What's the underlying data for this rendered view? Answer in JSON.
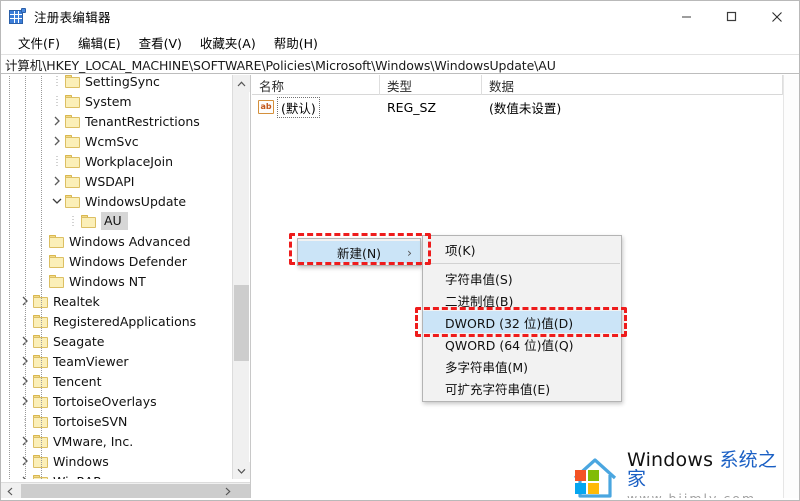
{
  "window": {
    "title": "注册表编辑器",
    "icon": "registry-editor-icon",
    "minimize_label": "最小化",
    "maximize_label": "最大化",
    "close_label": "关闭"
  },
  "menubar": {
    "items": [
      {
        "label": "文件(F)",
        "name": "menu-file"
      },
      {
        "label": "编辑(E)",
        "name": "menu-edit"
      },
      {
        "label": "查看(V)",
        "name": "menu-view"
      },
      {
        "label": "收藏夹(A)",
        "name": "menu-favorites"
      },
      {
        "label": "帮助(H)",
        "name": "menu-help"
      }
    ]
  },
  "address": {
    "path": "计算机\\HKEY_LOCAL_MACHINE\\SOFTWARE\\Policies\\Microsoft\\Windows\\WindowsUpdate\\AU"
  },
  "tree": {
    "items": [
      {
        "label": "SettingSync",
        "indent": 3,
        "expander": "none",
        "selected": false
      },
      {
        "label": "System",
        "indent": 3,
        "expander": "none",
        "selected": false
      },
      {
        "label": "TenantRestrictions",
        "indent": 3,
        "expander": "collapsed",
        "selected": false
      },
      {
        "label": "WcmSvc",
        "indent": 3,
        "expander": "collapsed",
        "selected": false
      },
      {
        "label": "WorkplaceJoin",
        "indent": 3,
        "expander": "none",
        "selected": false
      },
      {
        "label": "WSDAPI",
        "indent": 3,
        "expander": "collapsed",
        "selected": false
      },
      {
        "label": "WindowsUpdate",
        "indent": 3,
        "expander": "expanded",
        "selected": false
      },
      {
        "label": "AU",
        "indent": 4,
        "expander": "none",
        "selected": true
      },
      {
        "label": "Windows Advanced",
        "indent": 2,
        "expander": "none",
        "selected": false
      },
      {
        "label": "Windows Defender",
        "indent": 2,
        "expander": "none",
        "selected": false
      },
      {
        "label": "Windows NT",
        "indent": 2,
        "expander": "none",
        "selected": false
      },
      {
        "label": "Realtek",
        "indent": 1,
        "expander": "collapsed",
        "selected": false
      },
      {
        "label": "RegisteredApplications",
        "indent": 1,
        "expander": "none",
        "selected": false
      },
      {
        "label": "Seagate",
        "indent": 1,
        "expander": "collapsed",
        "selected": false
      },
      {
        "label": "TeamViewer",
        "indent": 1,
        "expander": "collapsed",
        "selected": false
      },
      {
        "label": "Tencent",
        "indent": 1,
        "expander": "collapsed",
        "selected": false
      },
      {
        "label": "TortoiseOverlays",
        "indent": 1,
        "expander": "collapsed",
        "selected": false
      },
      {
        "label": "TortoiseSVN",
        "indent": 1,
        "expander": "none",
        "selected": false
      },
      {
        "label": "VMware, Inc.",
        "indent": 1,
        "expander": "collapsed",
        "selected": false
      },
      {
        "label": "Windows",
        "indent": 1,
        "expander": "collapsed",
        "selected": false
      },
      {
        "label": "WinRAR",
        "indent": 1,
        "expander": "collapsed",
        "selected": false
      }
    ]
  },
  "list": {
    "columns": [
      {
        "label": "名称",
        "name": "column-name"
      },
      {
        "label": "类型",
        "name": "column-type"
      },
      {
        "label": "数据",
        "name": "column-data"
      }
    ],
    "rows": [
      {
        "icon": "string-value-icon",
        "name": "(默认)",
        "type": "REG_SZ",
        "data": "(数值未设置)"
      }
    ]
  },
  "context_menu": {
    "new_label": "新建(N)",
    "submenu_arrow": "›",
    "submenu": [
      {
        "label": "项(K)",
        "name": "ctx-key",
        "highlighted": false,
        "separator_after": true
      },
      {
        "label": "字符串值(S)",
        "name": "ctx-string-value",
        "highlighted": false,
        "separator_after": false
      },
      {
        "label": "二进制值(B)",
        "name": "ctx-binary-value",
        "highlighted": false,
        "separator_after": false
      },
      {
        "label": "DWORD (32 位)值(D)",
        "name": "ctx-dword-32",
        "highlighted": true,
        "separator_after": false
      },
      {
        "label": "QWORD (64 位)值(Q)",
        "name": "ctx-qword-64",
        "highlighted": false,
        "separator_after": false
      },
      {
        "label": "多字符串值(M)",
        "name": "ctx-multi-string-value",
        "highlighted": false,
        "separator_after": false
      },
      {
        "label": "可扩充字符串值(E)",
        "name": "ctx-expandable-string",
        "highlighted": false,
        "separator_after": false
      }
    ]
  },
  "annotations": {
    "highlight_color": "#ee1c1c",
    "boxes": [
      "新建(N)",
      "DWORD (32 位)值(D)"
    ]
  },
  "watermark": {
    "brand": "Windows ",
    "brand_cn": "系统之家",
    "url": "www.bjjmlv.com"
  },
  "colors": {
    "selection_blue": "#cbe4f7",
    "annotation_red": "#ee1c1c",
    "folder_yellow": "#fbefb8",
    "title_icon_blue": "#3b7dd8"
  }
}
